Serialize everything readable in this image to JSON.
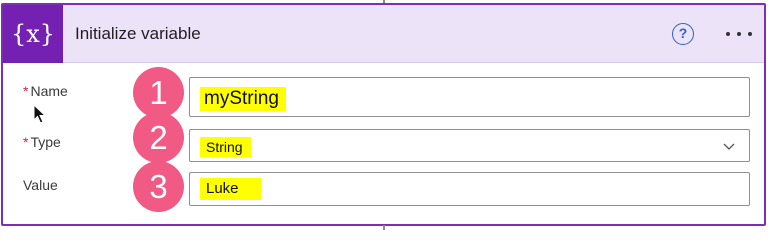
{
  "action": {
    "icon": "curly-braces-variable-icon",
    "icon_text": "{x}",
    "title": "Initialize variable",
    "help_icon": "question-circle-icon",
    "help_label": "?",
    "more_icon": "ellipsis-icon"
  },
  "form": {
    "required_marker": "*",
    "name": {
      "label": "Name",
      "value": "myString"
    },
    "type": {
      "label": "Type",
      "value": "String",
      "dropdown_icon": "chevron-down-icon"
    },
    "value": {
      "label": "Value",
      "value": "Luke"
    }
  },
  "annotations": [
    {
      "number": "1",
      "target": "name"
    },
    {
      "number": "2",
      "target": "type"
    },
    {
      "number": "3",
      "target": "value"
    }
  ],
  "colors": {
    "accent": "#7421b3",
    "header_bg": "#ece3f8",
    "highlight": "#ffff00",
    "badge": "#f05a85",
    "required": "#c4263e",
    "help": "#2f5fd0"
  }
}
